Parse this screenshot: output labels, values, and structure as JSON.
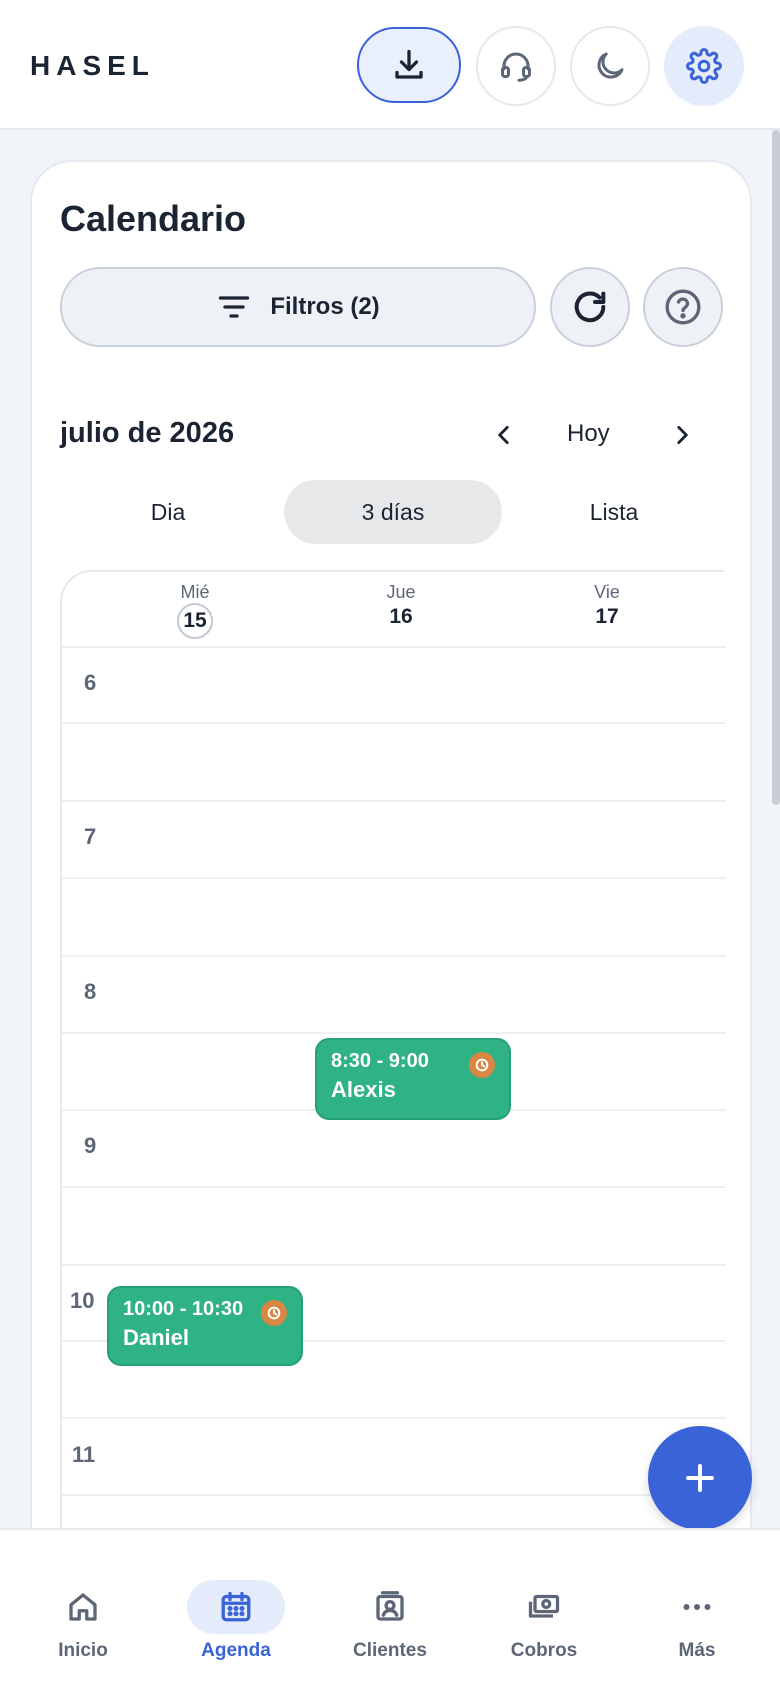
{
  "app": {
    "brand": "HASEL",
    "accent_color": "#3a63d8",
    "event_color": "#2fb284"
  },
  "header": {
    "buttons": [
      {
        "icon": "download-icon"
      },
      {
        "icon": "headset-icon"
      },
      {
        "icon": "moon-icon"
      },
      {
        "icon": "gear-icon"
      }
    ]
  },
  "calendar": {
    "title": "Calendario",
    "filters_label": "Filtros (2)",
    "month_label": "julio de 2026",
    "today_label": "Hoy",
    "views": [
      "Dia",
      "3 días",
      "Lista"
    ],
    "active_view": "3 días",
    "days": [
      {
        "name": "Mié",
        "number": "15",
        "is_today": true
      },
      {
        "name": "Jue",
        "number": "16",
        "is_today": false
      },
      {
        "name": "Vie",
        "number": "17",
        "is_today": false
      }
    ],
    "hours": [
      "6",
      "7",
      "8",
      "9",
      "10",
      "11"
    ],
    "events": [
      {
        "time": "8:30 - 9:00",
        "name": "Alexis",
        "day": "16"
      },
      {
        "time": "10:00 - 10:30",
        "name": "Daniel",
        "day": "15"
      }
    ]
  },
  "bottom_nav": {
    "items": [
      {
        "label": "Inicio",
        "icon": "home-icon"
      },
      {
        "label": "Agenda",
        "icon": "calendar-icon",
        "active": true
      },
      {
        "label": "Clientes",
        "icon": "contacts-icon"
      },
      {
        "label": "Cobros",
        "icon": "money-icon"
      },
      {
        "label": "Más",
        "icon": "more-icon"
      }
    ]
  }
}
